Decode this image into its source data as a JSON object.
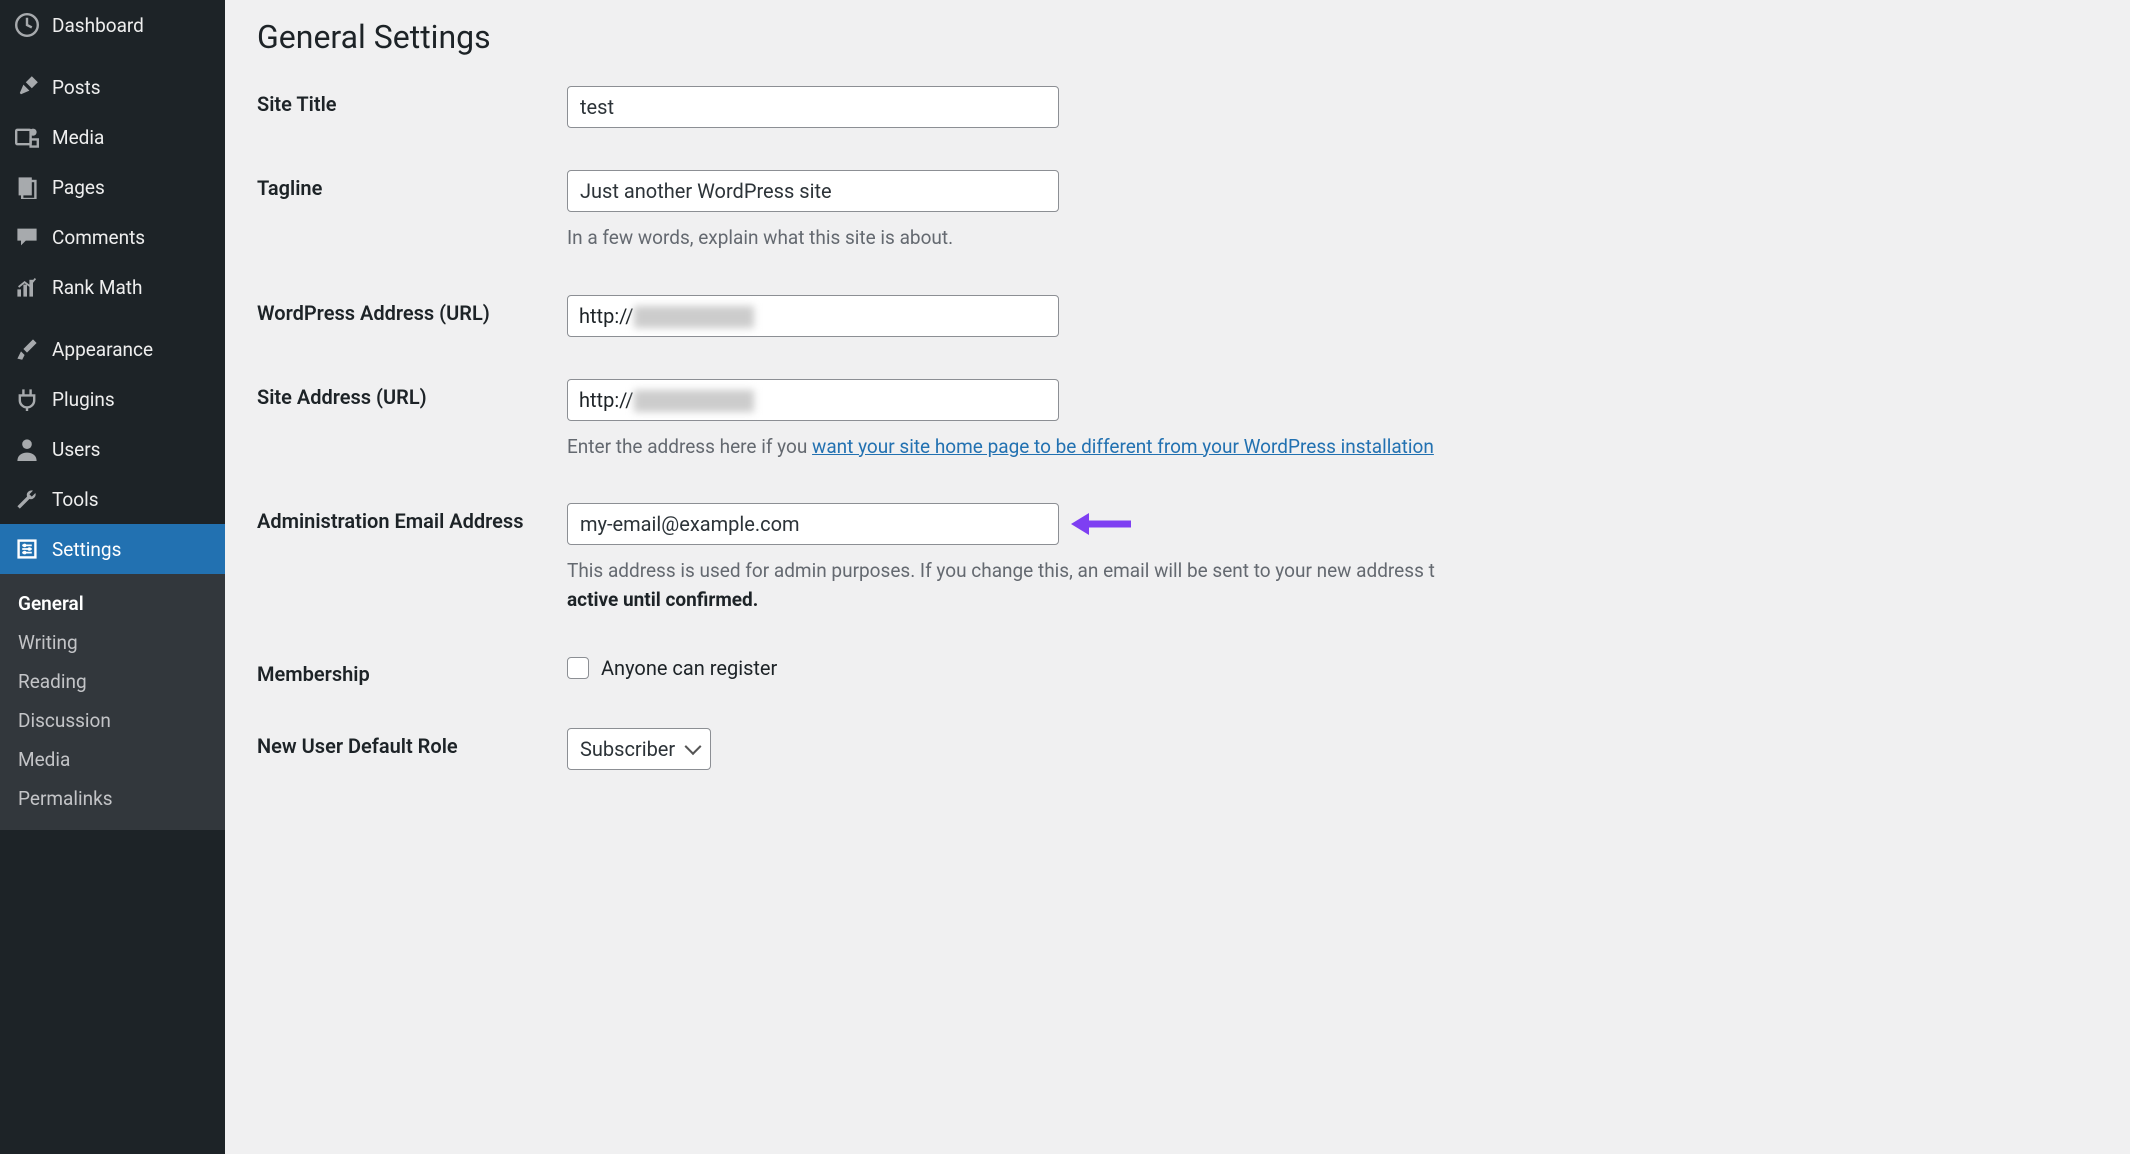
{
  "sidebar": {
    "items": [
      {
        "icon": "dashboard",
        "label": "Dashboard"
      },
      {
        "icon": "pin",
        "label": "Posts"
      },
      {
        "icon": "media",
        "label": "Media"
      },
      {
        "icon": "pages",
        "label": "Pages"
      },
      {
        "icon": "comment",
        "label": "Comments"
      },
      {
        "icon": "chart",
        "label": "Rank Math"
      },
      {
        "icon": "brush",
        "label": "Appearance"
      },
      {
        "icon": "plug",
        "label": "Plugins"
      },
      {
        "icon": "user",
        "label": "Users"
      },
      {
        "icon": "wrench",
        "label": "Tools"
      },
      {
        "icon": "sliders",
        "label": "Settings"
      }
    ],
    "sub": [
      "General",
      "Writing",
      "Reading",
      "Discussion",
      "Media",
      "Permalinks"
    ]
  },
  "page": {
    "title": "General Settings"
  },
  "fields": {
    "site_title": {
      "label": "Site Title",
      "value": "test"
    },
    "tagline": {
      "label": "Tagline",
      "value": "Just another WordPress site",
      "desc": "In a few words, explain what this site is about."
    },
    "wp_url": {
      "label": "WordPress Address (URL)",
      "prefix": "http://"
    },
    "site_url": {
      "label": "Site Address (URL)",
      "prefix": "http://",
      "desc_pre": "Enter the address here if you ",
      "desc_link": "want your site home page to be different from your WordPress installation"
    },
    "admin_email": {
      "label": "Administration Email Address",
      "value": "my-email@example.com",
      "desc_a": "This address is used for admin purposes. If you change this, an email will be sent to your new address t",
      "desc_b": "active until confirmed."
    },
    "membership": {
      "label": "Membership",
      "checkbox_label": "Anyone can register"
    },
    "default_role": {
      "label": "New User Default Role",
      "value": "Subscriber"
    }
  }
}
